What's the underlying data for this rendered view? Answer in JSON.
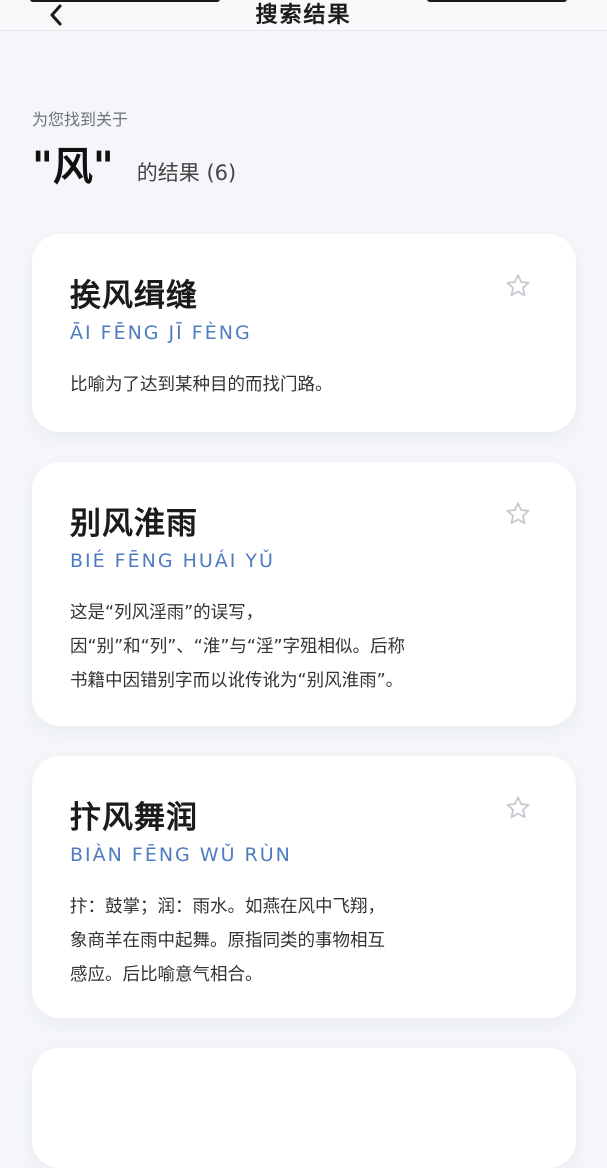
{
  "nav": {
    "title": "搜索结果",
    "back_icon": "chevron-left-icon"
  },
  "search": {
    "intro": "为您找到关于",
    "query": "\"风\"",
    "result_text": "的结果 (6)"
  },
  "results": [
    {
      "title": "挨风缉缝",
      "pinyin": "ĀI FĒNG JĪ FÈNG",
      "definition": [
        "比喻为了达到某种目的而找门路。"
      ],
      "favorite_icon": "star-outline-icon"
    },
    {
      "title": "别风淮雨",
      "pinyin": "BIÉ FĒNG HUÁI YǓ",
      "definition": [
        "这是“列风淫雨”的误写，",
        "因“别”和“列”、“淮”与“淫”字殂相似。后称",
        "书籍中因错别字而以讹传讹为“别风淮雨”。"
      ],
      "favorite_icon": "star-outline-icon"
    },
    {
      "title": "抃风舞润",
      "pinyin": "BIÀN FĒNG WǓ RÙN",
      "definition": [
        "抃：鼓掌；润：雨水。如燕在风中飞翔，",
        "象商羊在雨中起舞。原指同类的事物相互",
        "感应。后比喻意气相合。"
      ],
      "favorite_icon": "star-outline-icon"
    }
  ],
  "colors": {
    "background": "#f4f6f9",
    "card": "#ffffff",
    "pinyin": "#4f7cc0",
    "star": "#c4c8ce"
  }
}
